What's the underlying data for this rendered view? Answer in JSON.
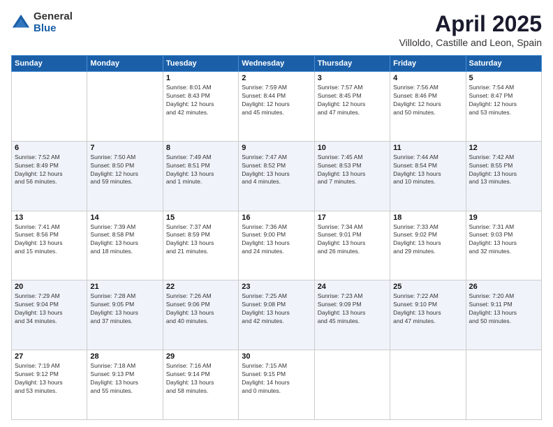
{
  "logo": {
    "general": "General",
    "blue": "Blue"
  },
  "title": "April 2025",
  "subtitle": "Villoldo, Castille and Leon, Spain",
  "headers": [
    "Sunday",
    "Monday",
    "Tuesday",
    "Wednesday",
    "Thursday",
    "Friday",
    "Saturday"
  ],
  "weeks": [
    [
      {
        "day": "",
        "info": ""
      },
      {
        "day": "",
        "info": ""
      },
      {
        "day": "1",
        "info": "Sunrise: 8:01 AM\nSunset: 8:43 PM\nDaylight: 12 hours\nand 42 minutes."
      },
      {
        "day": "2",
        "info": "Sunrise: 7:59 AM\nSunset: 8:44 PM\nDaylight: 12 hours\nand 45 minutes."
      },
      {
        "day": "3",
        "info": "Sunrise: 7:57 AM\nSunset: 8:45 PM\nDaylight: 12 hours\nand 47 minutes."
      },
      {
        "day": "4",
        "info": "Sunrise: 7:56 AM\nSunset: 8:46 PM\nDaylight: 12 hours\nand 50 minutes."
      },
      {
        "day": "5",
        "info": "Sunrise: 7:54 AM\nSunset: 8:47 PM\nDaylight: 12 hours\nand 53 minutes."
      }
    ],
    [
      {
        "day": "6",
        "info": "Sunrise: 7:52 AM\nSunset: 8:49 PM\nDaylight: 12 hours\nand 56 minutes."
      },
      {
        "day": "7",
        "info": "Sunrise: 7:50 AM\nSunset: 8:50 PM\nDaylight: 12 hours\nand 59 minutes."
      },
      {
        "day": "8",
        "info": "Sunrise: 7:49 AM\nSunset: 8:51 PM\nDaylight: 13 hours\nand 1 minute."
      },
      {
        "day": "9",
        "info": "Sunrise: 7:47 AM\nSunset: 8:52 PM\nDaylight: 13 hours\nand 4 minutes."
      },
      {
        "day": "10",
        "info": "Sunrise: 7:45 AM\nSunset: 8:53 PM\nDaylight: 13 hours\nand 7 minutes."
      },
      {
        "day": "11",
        "info": "Sunrise: 7:44 AM\nSunset: 8:54 PM\nDaylight: 13 hours\nand 10 minutes."
      },
      {
        "day": "12",
        "info": "Sunrise: 7:42 AM\nSunset: 8:55 PM\nDaylight: 13 hours\nand 13 minutes."
      }
    ],
    [
      {
        "day": "13",
        "info": "Sunrise: 7:41 AM\nSunset: 8:56 PM\nDaylight: 13 hours\nand 15 minutes."
      },
      {
        "day": "14",
        "info": "Sunrise: 7:39 AM\nSunset: 8:58 PM\nDaylight: 13 hours\nand 18 minutes."
      },
      {
        "day": "15",
        "info": "Sunrise: 7:37 AM\nSunset: 8:59 PM\nDaylight: 13 hours\nand 21 minutes."
      },
      {
        "day": "16",
        "info": "Sunrise: 7:36 AM\nSunset: 9:00 PM\nDaylight: 13 hours\nand 24 minutes."
      },
      {
        "day": "17",
        "info": "Sunrise: 7:34 AM\nSunset: 9:01 PM\nDaylight: 13 hours\nand 26 minutes."
      },
      {
        "day": "18",
        "info": "Sunrise: 7:33 AM\nSunset: 9:02 PM\nDaylight: 13 hours\nand 29 minutes."
      },
      {
        "day": "19",
        "info": "Sunrise: 7:31 AM\nSunset: 9:03 PM\nDaylight: 13 hours\nand 32 minutes."
      }
    ],
    [
      {
        "day": "20",
        "info": "Sunrise: 7:29 AM\nSunset: 9:04 PM\nDaylight: 13 hours\nand 34 minutes."
      },
      {
        "day": "21",
        "info": "Sunrise: 7:28 AM\nSunset: 9:05 PM\nDaylight: 13 hours\nand 37 minutes."
      },
      {
        "day": "22",
        "info": "Sunrise: 7:26 AM\nSunset: 9:06 PM\nDaylight: 13 hours\nand 40 minutes."
      },
      {
        "day": "23",
        "info": "Sunrise: 7:25 AM\nSunset: 9:08 PM\nDaylight: 13 hours\nand 42 minutes."
      },
      {
        "day": "24",
        "info": "Sunrise: 7:23 AM\nSunset: 9:09 PM\nDaylight: 13 hours\nand 45 minutes."
      },
      {
        "day": "25",
        "info": "Sunrise: 7:22 AM\nSunset: 9:10 PM\nDaylight: 13 hours\nand 47 minutes."
      },
      {
        "day": "26",
        "info": "Sunrise: 7:20 AM\nSunset: 9:11 PM\nDaylight: 13 hours\nand 50 minutes."
      }
    ],
    [
      {
        "day": "27",
        "info": "Sunrise: 7:19 AM\nSunset: 9:12 PM\nDaylight: 13 hours\nand 53 minutes."
      },
      {
        "day": "28",
        "info": "Sunrise: 7:18 AM\nSunset: 9:13 PM\nDaylight: 13 hours\nand 55 minutes."
      },
      {
        "day": "29",
        "info": "Sunrise: 7:16 AM\nSunset: 9:14 PM\nDaylight: 13 hours\nand 58 minutes."
      },
      {
        "day": "30",
        "info": "Sunrise: 7:15 AM\nSunset: 9:15 PM\nDaylight: 14 hours\nand 0 minutes."
      },
      {
        "day": "",
        "info": ""
      },
      {
        "day": "",
        "info": ""
      },
      {
        "day": "",
        "info": ""
      }
    ]
  ]
}
